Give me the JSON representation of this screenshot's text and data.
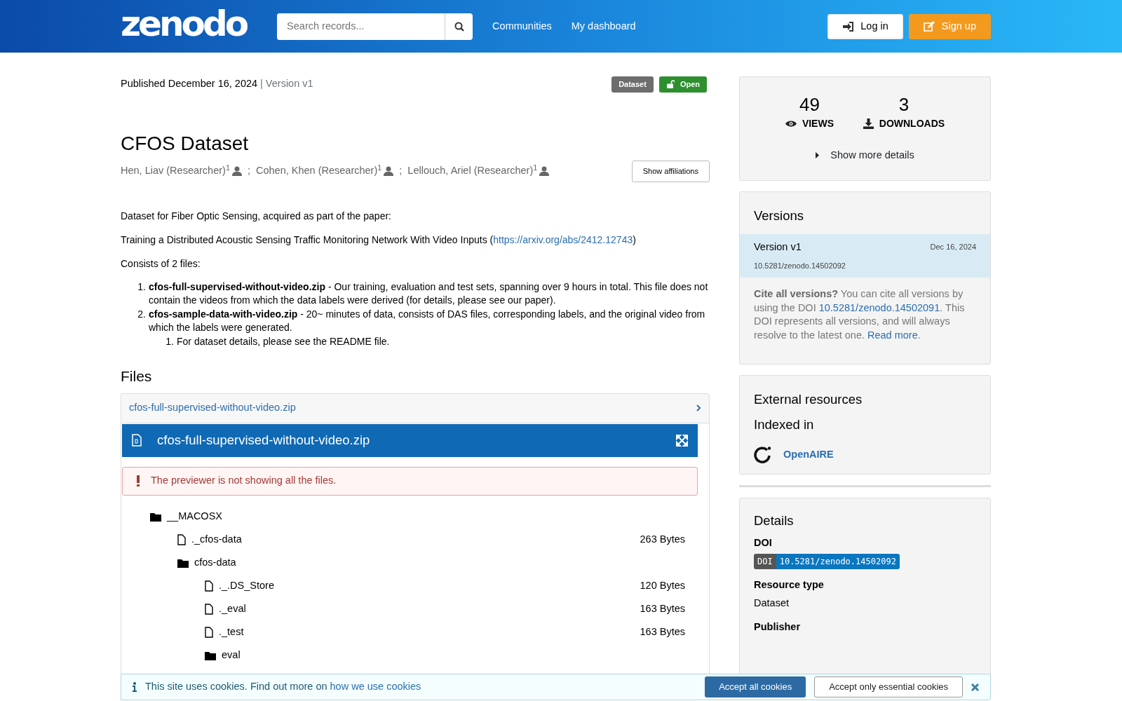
{
  "header": {
    "logo": "zenodo",
    "search": {
      "placeholder": "Search records..."
    },
    "nav": [
      "Communities",
      "My dashboard"
    ],
    "login": "Log in",
    "signup": "Sign up"
  },
  "record": {
    "published": "Published December 16, 2024",
    "version": "| Version v1",
    "badges": [
      {
        "label": "Dataset",
        "kind": "type"
      },
      {
        "label": "Open",
        "kind": "access"
      }
    ],
    "title": "CFOS Dataset",
    "creators": [
      {
        "name": "Hen, Liav (Researcher)",
        "sup": "1",
        "separator": ";"
      },
      {
        "name": "Cohen, Khen (Researcher)",
        "sup": "1",
        "separator": ";"
      },
      {
        "name": "Lellouch, Ariel (Researcher)",
        "sup": "1"
      }
    ],
    "show_affiliations": "Show affiliations",
    "description": [
      {
        "kind": "text",
        "text": "Dataset for Fiber Optic Sensing, acquired as part of the paper:"
      },
      {
        "kind": "link",
        "text": "Training a Distributed Acoustic Sensing Traffic Monitoring Network With Video Inputs (",
        "link": "https://arxiv.org/abs/2412.12743",
        "after": ")"
      },
      {
        "kind": "text",
        "text": "Consists of 2 files:"
      },
      {
        "kind": "list",
        "items": [
          {
            "marker": "1.",
            "text": "**cfos-full-supervised-without-video.zip** - Our training, evaluation and test sets, spanning over 9 hours in total. This file does not contain the videos from which the data labels were derived (for details, please see our paper)."
          },
          {
            "marker": "2.",
            "text": "**cfos-sample-data-with-video.zip** - 20~ minutes of data, consists of DAS files, corresponding labels, and the original video from which the labels were generated.",
            "children": [
              {
                "marker": "1.",
                "text": "For dataset details, please see the README file."
              }
            ]
          }
        ]
      }
    ]
  },
  "files": {
    "heading": "Files",
    "accordion": "cfos-full-supervised-without-video.zip",
    "preview_title": "cfos-full-supervised-without-video.zip",
    "alert": "The previewer is not showing all the files.",
    "tree": [
      {
        "name": "__MACOSX",
        "kind": "folder",
        "children": [
          {
            "name": "._cfos-data",
            "kind": "file",
            "size": "263 Bytes"
          },
          {
            "name": "cfos-data",
            "kind": "folder",
            "children": [
              {
                "name": "._.DS_Store",
                "kind": "file",
                "size": "120 Bytes"
              },
              {
                "name": "._eval",
                "kind": "file",
                "size": "163 Bytes"
              },
              {
                "name": "._test",
                "kind": "file",
                "size": "163 Bytes"
              },
              {
                "name": "eval",
                "kind": "folder"
              }
            ]
          }
        ]
      }
    ]
  },
  "stats": {
    "views": "49",
    "views_label": "VIEWS",
    "downloads": "3",
    "downloads_label": "DOWNLOADS",
    "more": "Show more details"
  },
  "versions": {
    "title": "Versions",
    "items": [
      {
        "label": "Version v1",
        "date": "Dec 16, 2024",
        "doi": "10.5281/zenodo.14502092",
        "selected": true
      }
    ],
    "cite": [
      {
        "kind": "text",
        "text": "**Cite all versions?** You can cite all versions by using the DOI "
      },
      {
        "kind": "link",
        "text": "10.5281/zenodo.14502091"
      },
      {
        "kind": "text",
        "text": ". This DOI represents all versions, and will always resolve to the latest one. "
      },
      {
        "kind": "link",
        "text": "Read more"
      },
      {
        "kind": "text",
        "text": "."
      }
    ]
  },
  "external": {
    "title": "External resources",
    "subtitle": "Indexed in",
    "items": [
      "OpenAIRE"
    ]
  },
  "details": {
    "title": "Details",
    "fields": [
      {
        "label": "DOI",
        "kind": "doi",
        "badge": {
          "prefix": "DOI",
          "doi": "10.5281/zenodo.14502092"
        }
      },
      {
        "label": "Resource type",
        "kind": "text",
        "value": "Dataset"
      },
      {
        "label": "Publisher",
        "kind": "text"
      }
    ]
  },
  "cookie": {
    "text": "This site uses cookies. Find out more on ",
    "link": "how we use cookies",
    "accept_all": "Accept all cookies",
    "essential": "Accept only essential cookies"
  }
}
